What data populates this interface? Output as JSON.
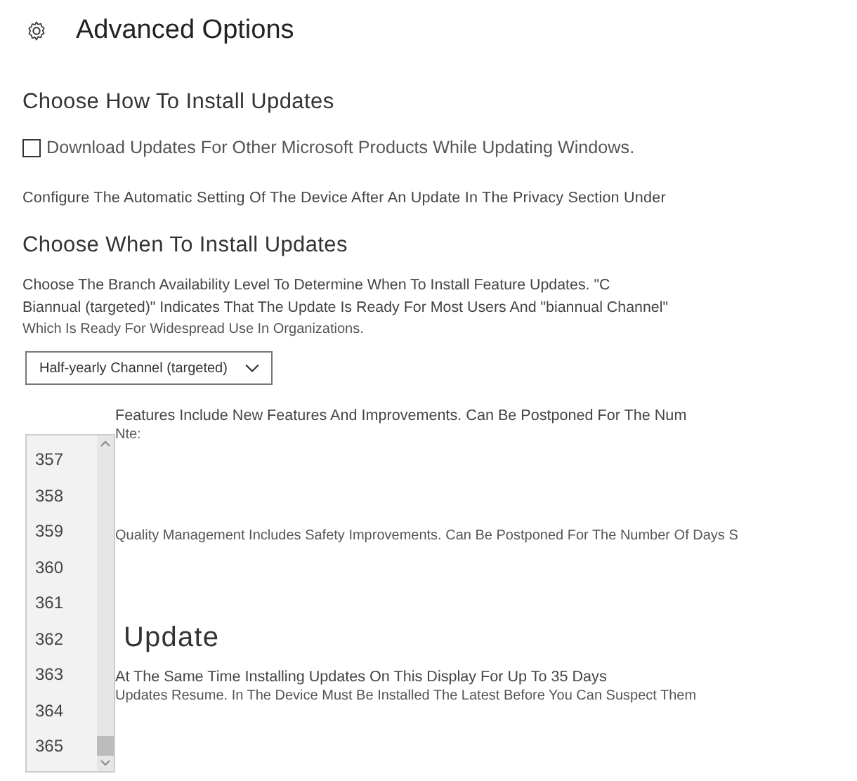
{
  "title": "Advanced Options",
  "how": {
    "heading": "Choose How To Install Updates",
    "checkbox": {
      "label": "Download Updates For Other Microsoft Products While Updating Windows.",
      "checked": false
    },
    "note": "Configure The Automatic Setting Of The Device After An Update In The Privacy Section Under"
  },
  "when": {
    "heading": "Choose When To Install Updates",
    "description": [
      "Choose The Branch Availability Level To Determine When To Install Feature Updates. \"C",
      "Biannual (targeted)\" Indicates That The Update Is Ready For Most Users And \"biannual Channel\"",
      "Which Is Ready For Widespread Use In Organizations."
    ],
    "dropdown": {
      "value": "Half-yearly Channel (targeted)"
    },
    "features": "Features Include New Features And Improvements. Can Be Postponed For The Num",
    "features_note": "Nte:",
    "quality": "Quality Management Includes Safety Improvements. Can Be Postponed For The Number Of Days S"
  },
  "pause": {
    "heading": "Update",
    "lines": [
      "At The Same Time Installing Updates On This Display For Up To 35 Days",
      "Updates Resume. In The Device Must Be Installed The Latest Before You Can Suspect Them"
    ]
  },
  "day_list": [
    "357",
    "358",
    "359",
    "360",
    "361",
    "362",
    "363",
    "364",
    "365"
  ]
}
